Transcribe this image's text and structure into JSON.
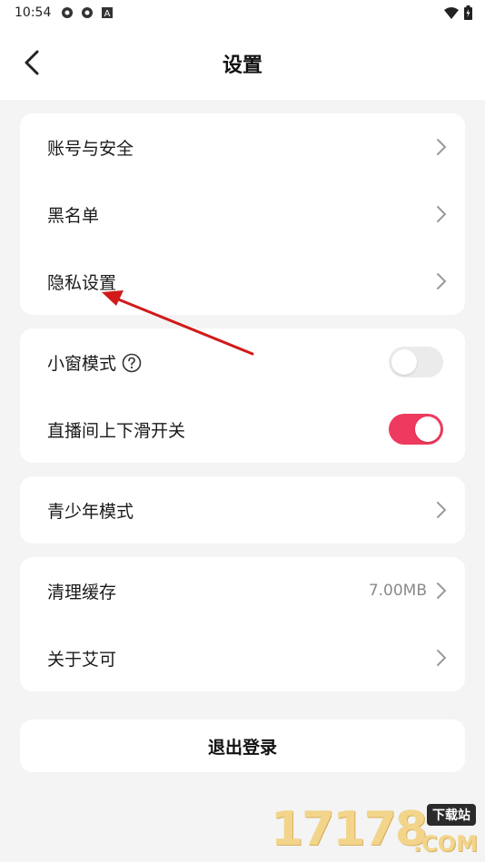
{
  "status_bar": {
    "time": "10:54",
    "left_icons": [
      "settings-gear-icon",
      "settings-gear-icon",
      "a-box-icon"
    ],
    "right_icons": [
      "wifi-icon",
      "battery-icon"
    ]
  },
  "header": {
    "title": "设置",
    "back_icon": "chevron-left-icon"
  },
  "groups": [
    {
      "items": [
        {
          "label": "账号与安全",
          "type": "nav"
        },
        {
          "label": "黑名单",
          "type": "nav"
        },
        {
          "label": "隐私设置",
          "type": "nav"
        }
      ]
    },
    {
      "items": [
        {
          "label": "小窗模式",
          "type": "toggle",
          "on": false,
          "help_icon": "question-circle-icon"
        },
        {
          "label": "直播间上下滑开关",
          "type": "toggle",
          "on": true
        }
      ]
    },
    {
      "items": [
        {
          "label": "青少年模式",
          "type": "nav"
        }
      ]
    },
    {
      "items": [
        {
          "label": "清理缓存",
          "type": "nav",
          "value": "7.00MB"
        },
        {
          "label": "关于艾可",
          "type": "nav"
        }
      ]
    }
  ],
  "logout_label": "退出登录",
  "colors": {
    "toggle_on": "#ee3a5e",
    "toggle_off": "#ebebeb",
    "annotation_arrow": "#d11a1a",
    "background": "#f4f4f4"
  },
  "watermark": {
    "number": "17178",
    "badge": "下载站",
    "suffix": ".COM"
  }
}
